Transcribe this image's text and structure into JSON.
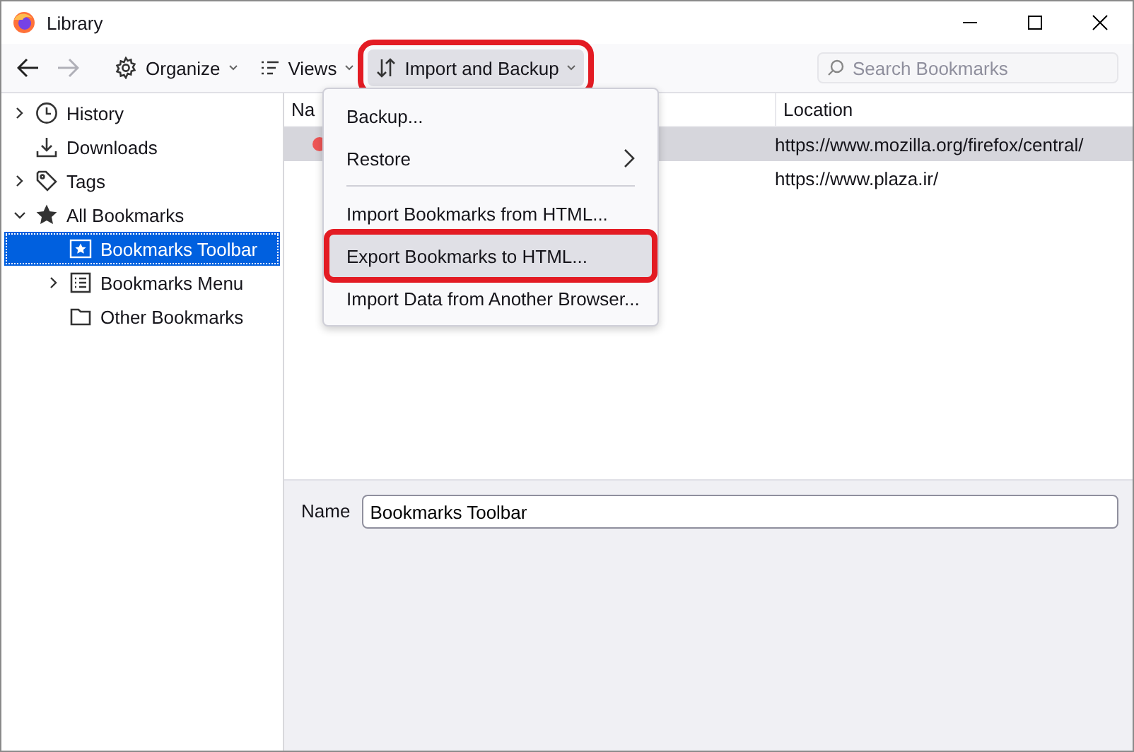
{
  "window": {
    "title": "Library"
  },
  "toolbar": {
    "back": {
      "disabled": false
    },
    "forward": {
      "disabled": true
    },
    "buttons": [
      {
        "kind": "organize",
        "label": "Organize",
        "open": false,
        "highlighted": false
      },
      {
        "kind": "views",
        "label": "Views",
        "open": false,
        "highlighted": false
      },
      {
        "kind": "import",
        "label": "Import and Backup",
        "open": true,
        "highlighted": true
      }
    ],
    "search": {
      "placeholder": "Search Bookmarks"
    }
  },
  "sidebar": {
    "items": [
      {
        "kind": "history",
        "label": "History",
        "expanded": false,
        "selected": false
      },
      {
        "kind": "downloads",
        "label": "Downloads",
        "selected": false
      },
      {
        "kind": "tags",
        "label": "Tags",
        "expanded": false,
        "selected": false
      },
      {
        "kind": "all",
        "label": "All Bookmarks",
        "expanded": true,
        "selected": false,
        "children": [
          {
            "kind": "toolbar",
            "label": "Bookmarks Toolbar",
            "selected": true
          },
          {
            "kind": "menu",
            "label": "Bookmarks Menu",
            "expanded": false,
            "selected": false
          },
          {
            "kind": "folder",
            "label": "Other Bookmarks",
            "selected": false
          }
        ]
      }
    ]
  },
  "table": {
    "columns": [
      "Na",
      "Location"
    ],
    "rows": [
      {
        "location": "https://www.mozilla.org/firefox/central/",
        "selected": true
      },
      {
        "location": "https://www.plaza.ir/",
        "selected": false
      }
    ]
  },
  "menu": {
    "items": [
      {
        "kind": "item",
        "label": "Backup...",
        "highlighted": false,
        "selected": false
      },
      {
        "kind": "submenu",
        "label": "Restore",
        "highlighted": false,
        "selected": false
      },
      {
        "kind": "separator"
      },
      {
        "kind": "item",
        "label": "Import Bookmarks from HTML...",
        "highlighted": false,
        "selected": false
      },
      {
        "kind": "item",
        "label": "Export Bookmarks to HTML...",
        "highlighted": true,
        "selected": true
      },
      {
        "kind": "item",
        "label": "Import Data from Another Browser...",
        "highlighted": false,
        "selected": false
      }
    ]
  },
  "details": {
    "name_label": "Name",
    "name_value": "Bookmarks Toolbar"
  }
}
